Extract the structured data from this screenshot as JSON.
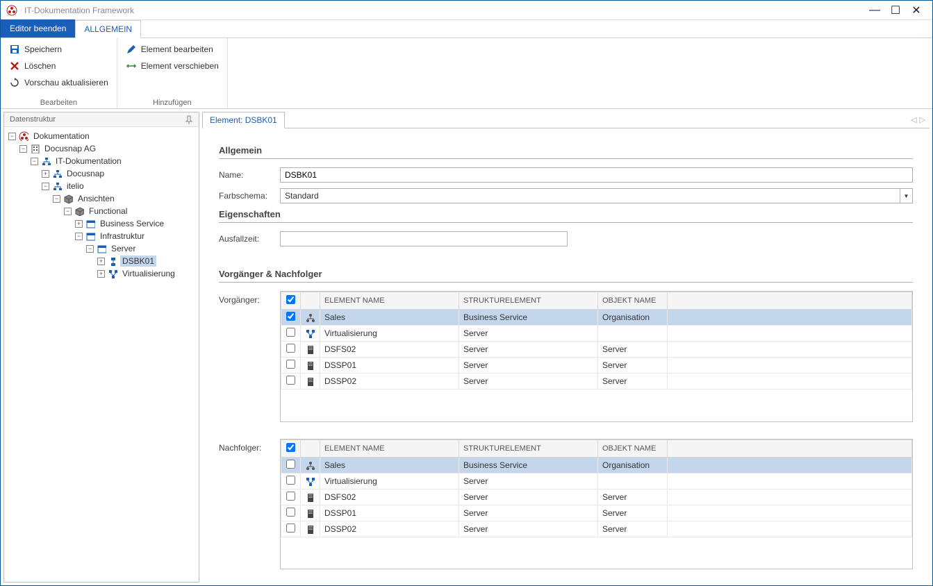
{
  "window": {
    "title": "IT-Dokumentation Framework"
  },
  "tabs": {
    "editor_beenden": "Editor beenden",
    "allgemein": "ALLGEMEIN"
  },
  "ribbon": {
    "group1_label": "Bearbeiten",
    "group2_label": "Hinzufügen",
    "speichern": "Speichern",
    "loeschen": "Löschen",
    "vorschau": "Vorschau aktualisieren",
    "bearbeiten": "Element bearbeiten",
    "verschieben": "Element verschieben"
  },
  "sidebar": {
    "title": "Datenstruktur",
    "tree": [
      {
        "level": 0,
        "label": "Dokumentation",
        "icon": "app"
      },
      {
        "level": 1,
        "label": "Docusnap AG",
        "icon": "building"
      },
      {
        "level": 2,
        "label": "IT-Dokumentation",
        "icon": "diagram"
      },
      {
        "level": 3,
        "label": "Docusnap",
        "icon": "diagram"
      },
      {
        "level": 3,
        "label": "itelio",
        "icon": "diagram"
      },
      {
        "level": 4,
        "label": "Ansichten",
        "icon": "cube"
      },
      {
        "level": 5,
        "label": "Functional",
        "icon": "cube"
      },
      {
        "level": 6,
        "label": "Business Service",
        "icon": "window"
      },
      {
        "level": 6,
        "label": "Infrastruktur",
        "icon": "window"
      },
      {
        "level": 7,
        "label": "Server",
        "icon": "window"
      },
      {
        "level": 8,
        "label": "DSBK01",
        "icon": "node",
        "selected": true
      },
      {
        "level": 8,
        "label": "Virtualisierung",
        "icon": "nodes"
      }
    ]
  },
  "content": {
    "tab_label": "Element: DSBK01",
    "section_allgemein": "Allgemein",
    "name_label": "Name:",
    "name_value": "DSBK01",
    "farbschema_label": "Farbschema:",
    "farbschema_value": "Standard",
    "section_eigenschaften": "Eigenschaften",
    "ausfallzeit_label": "Ausfallzeit:",
    "ausfallzeit_value": "",
    "section_vn": "Vorgänger & Nachfolger",
    "vorgaenger_label": "Vorgänger:",
    "nachfolger_label": "Nachfolger:",
    "columns": {
      "element": "ELEMENT NAME",
      "struktur": "STRUKTURELEMENT",
      "objekt": "OBJEKT NAME"
    },
    "vorgaenger_rows": [
      {
        "checked": true,
        "icon": "org",
        "element": "Sales",
        "struktur": "Business Service",
        "objekt": "Organisation",
        "selected": true
      },
      {
        "checked": false,
        "icon": "nodes",
        "element": "Virtualisierung",
        "struktur": "Server",
        "objekt": ""
      },
      {
        "checked": false,
        "icon": "server",
        "element": "DSFS02",
        "struktur": "Server",
        "objekt": "Server"
      },
      {
        "checked": false,
        "icon": "server",
        "element": "DSSP01",
        "struktur": "Server",
        "objekt": "Server"
      },
      {
        "checked": false,
        "icon": "server",
        "element": "DSSP02",
        "struktur": "Server",
        "objekt": "Server"
      }
    ],
    "nachfolger_rows": [
      {
        "checked": false,
        "icon": "org",
        "element": "Sales",
        "struktur": "Business Service",
        "objekt": "Organisation",
        "selected": true
      },
      {
        "checked": false,
        "icon": "nodes",
        "element": "Virtualisierung",
        "struktur": "Server",
        "objekt": ""
      },
      {
        "checked": false,
        "icon": "server",
        "element": "DSFS02",
        "struktur": "Server",
        "objekt": "Server"
      },
      {
        "checked": false,
        "icon": "server",
        "element": "DSSP01",
        "struktur": "Server",
        "objekt": "Server"
      },
      {
        "checked": false,
        "icon": "server",
        "element": "DSSP02",
        "struktur": "Server",
        "objekt": "Server"
      }
    ]
  }
}
